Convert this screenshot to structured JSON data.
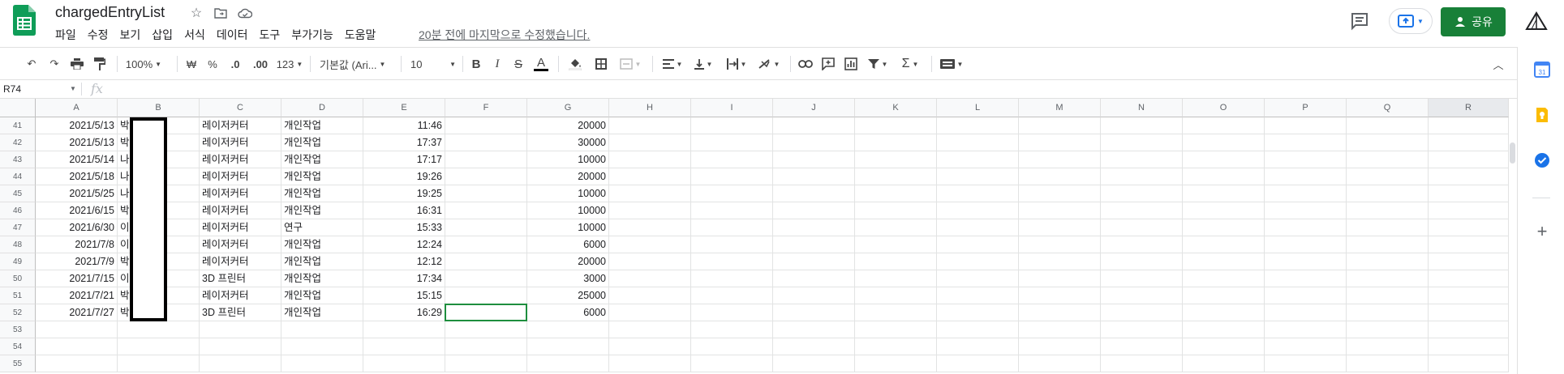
{
  "doc": {
    "title": "chargedEntryList",
    "last_edit": "20분 전에 마지막으로 수정했습니다.",
    "share_label": "공유"
  },
  "menu": [
    "파일",
    "수정",
    "보기",
    "삽입",
    "서식",
    "데이터",
    "도구",
    "부가기능",
    "도움말"
  ],
  "toolbar": {
    "zoom": "100%",
    "currency": "₩",
    "percent": "%",
    "dec_decrease": ".0",
    "dec_increase": ".00",
    "more_formats": "123",
    "font": "기본값 (Ari...",
    "font_size": "10",
    "bold": "B",
    "italic": "I",
    "strike": "S",
    "text_color": "A"
  },
  "formula_bar": {
    "cell_ref": "R74",
    "fx": "fx",
    "value": ""
  },
  "columns": [
    "A",
    "B",
    "C",
    "D",
    "E",
    "F",
    "G",
    "H",
    "I",
    "J",
    "K",
    "L",
    "M",
    "N",
    "O",
    "P",
    "Q",
    "R"
  ],
  "rows": [
    {
      "num": "41",
      "A": "2021/5/13",
      "B": "박",
      "C": "레이저커터",
      "D": "개인작업",
      "E": "11:46",
      "G": "20000"
    },
    {
      "num": "42",
      "A": "2021/5/13",
      "B": "박",
      "C": "레이저커터",
      "D": "개인작업",
      "E": "17:37",
      "G": "30000"
    },
    {
      "num": "43",
      "A": "2021/5/14",
      "B": "나",
      "C": "레이저커터",
      "D": "개인작업",
      "E": "17:17",
      "G": "10000"
    },
    {
      "num": "44",
      "A": "2021/5/18",
      "B": "나",
      "C": "레이저커터",
      "D": "개인작업",
      "E": "19:26",
      "G": "20000"
    },
    {
      "num": "45",
      "A": "2021/5/25",
      "B": "나",
      "C": "레이저커터",
      "D": "개인작업",
      "E": "19:25",
      "G": "10000"
    },
    {
      "num": "46",
      "A": "2021/6/15",
      "B": "박",
      "C": "레이저커터",
      "D": "개인작업",
      "E": "16:31",
      "G": "10000"
    },
    {
      "num": "47",
      "A": "2021/6/30",
      "B": "이",
      "C": "레이저커터",
      "D": "연구",
      "E": "15:33",
      "G": "10000"
    },
    {
      "num": "48",
      "A": "2021/7/8",
      "B": "이",
      "C": "레이저커터",
      "D": "개인작업",
      "E": "12:24",
      "G": "6000"
    },
    {
      "num": "49",
      "A": "2021/7/9",
      "B": "박",
      "C": "레이저커터",
      "D": "개인작업",
      "E": "12:12",
      "G": "20000"
    },
    {
      "num": "50",
      "A": "2021/7/15",
      "B": "이",
      "C": "3D 프린터",
      "D": "개인작업",
      "E": "17:34",
      "G": "3000"
    },
    {
      "num": "51",
      "A": "2021/7/21",
      "B": "박",
      "C": "레이저커터",
      "D": "개인작업",
      "E": "15:15",
      "G": "25000"
    },
    {
      "num": "52",
      "A": "2021/7/27",
      "B": "박",
      "C": "3D 프린터",
      "D": "개인작업",
      "E": "16:29",
      "G": "6000"
    },
    {
      "num": "53"
    },
    {
      "num": "54"
    },
    {
      "num": "55"
    }
  ],
  "colors": {
    "brand_green": "#188038",
    "select_green": "#1e8e3e"
  }
}
